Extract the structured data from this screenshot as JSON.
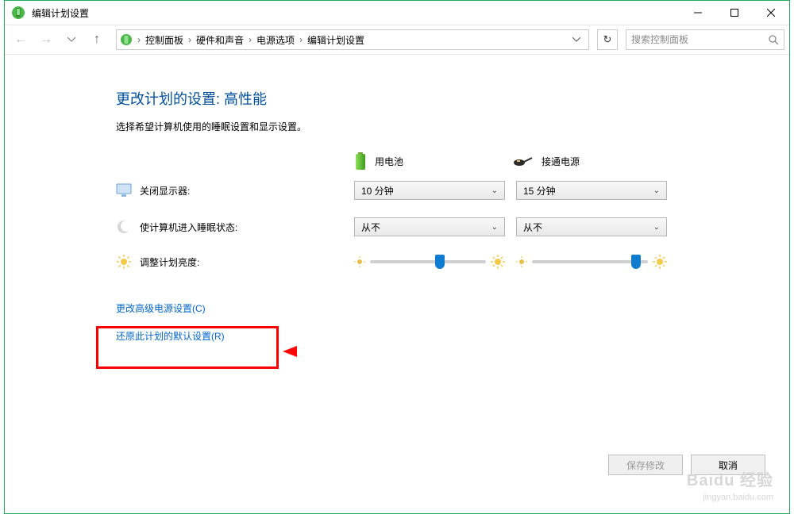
{
  "window": {
    "title": "编辑计划设置"
  },
  "breadcrumb": {
    "items": [
      "控制面板",
      "硬件和声音",
      "电源选项",
      "编辑计划设置"
    ]
  },
  "search": {
    "placeholder": "搜索控制面板"
  },
  "page": {
    "heading": "更改计划的设置: 高性能",
    "subheading": "选择希望计算机使用的睡眠设置和显示设置。"
  },
  "columns": {
    "battery": "用电池",
    "plugged": "接通电源"
  },
  "rows": {
    "display_off": {
      "label": "关闭显示器:",
      "battery_value": "10 分钟",
      "plugged_value": "15 分钟"
    },
    "sleep": {
      "label": "使计算机进入睡眠状态:",
      "battery_value": "从不",
      "plugged_value": "从不"
    },
    "brightness": {
      "label": "调整计划亮度:",
      "battery_percent": 60,
      "plugged_percent": 90
    }
  },
  "links": {
    "advanced": "更改高级电源设置(C)",
    "restore": "还原此计划的默认设置(R)"
  },
  "buttons": {
    "save": "保存修改",
    "cancel": "取消"
  },
  "watermark": {
    "brand": "Baidu 经验",
    "url": "jingyan.baidu.com"
  },
  "colors": {
    "border": "#24ab5a",
    "link": "#0066cc",
    "heading": "#00509e",
    "highlight": "#fb0000"
  }
}
